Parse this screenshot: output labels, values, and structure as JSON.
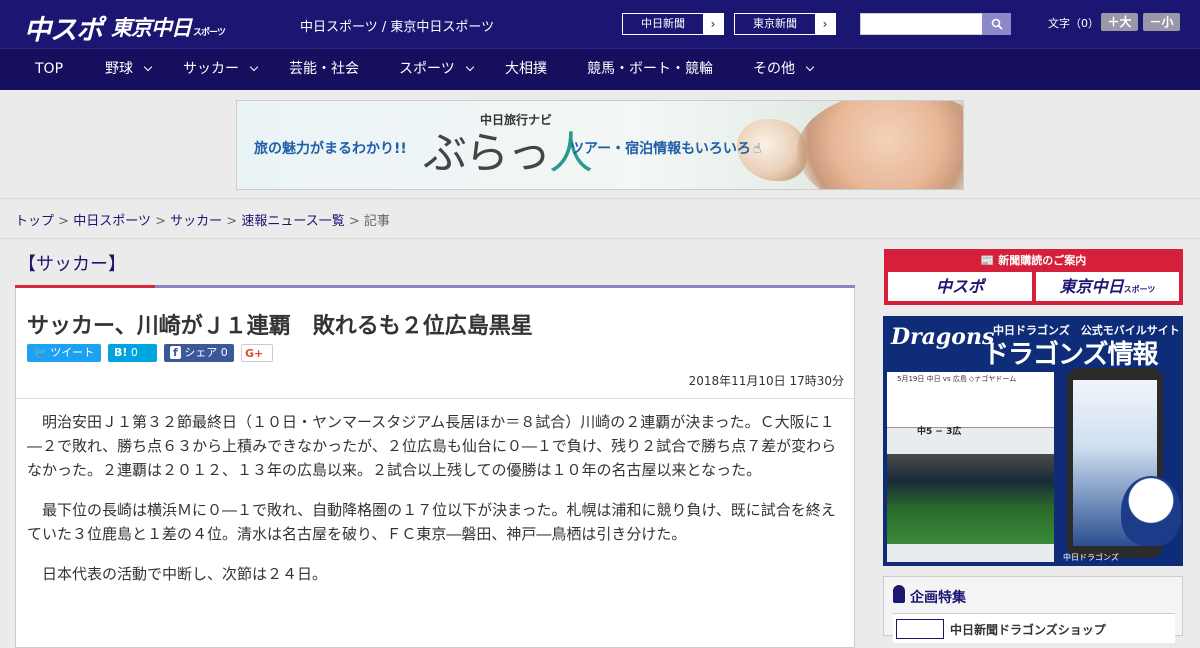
{
  "header": {
    "logo_chuspo": "中スポ",
    "logo_tokyo": "東京中日",
    "logo_tokyo_small": "スポーツ",
    "site_name": "中日スポーツ / 東京中日スポーツ",
    "paper_links": [
      {
        "label": "中日新聞",
        "arrow": "›"
      },
      {
        "label": "東京新聞",
        "arrow": "›"
      }
    ],
    "search_placeholder": "",
    "font_label": "文字（0）",
    "font_larger": "＋大",
    "font_smaller": "－小"
  },
  "nav": {
    "items": [
      {
        "label": "TOP",
        "has_menu": false
      },
      {
        "label": "野球",
        "has_menu": true
      },
      {
        "label": "サッカー",
        "has_menu": true
      },
      {
        "label": "芸能・社会",
        "has_menu": false
      },
      {
        "label": "スポーツ",
        "has_menu": true
      },
      {
        "label": "大相撲",
        "has_menu": false
      },
      {
        "label": "競馬・ボート・競輪",
        "has_menu": false
      },
      {
        "label": "その他",
        "has_menu": true
      }
    ]
  },
  "ad_banner": {
    "left_text": "旅の魅力がまるわかり!!",
    "navi_label": "中日旅行ナビ",
    "title_a": "ぶらっ",
    "title_b": "人",
    "right_text": "ツアー・宿泊情報もいろいろ"
  },
  "breadcrumb": {
    "items": [
      "トップ",
      "中日スポーツ",
      "サッカー",
      "速報ニュース一覧"
    ],
    "current": "記事",
    "separator": ">"
  },
  "article": {
    "category": "【サッカー】",
    "headline": "サッカー、川崎がＪ１連覇　敗れるも２位広島黒星",
    "share": {
      "tweet": "ツイート",
      "hatena_label": "B!",
      "hatena_count": "0",
      "facebook_label": "シェア",
      "facebook_count": "0",
      "gplus": "G+"
    },
    "date": "2018年11月10日 17時30分",
    "paragraphs": [
      "明治安田Ｊ１第３２節最終日（１０日・ヤンマースタジアム長居ほか＝８試合）川崎の２連覇が決まった。Ｃ大阪に１―２で敗れ、勝ち点６３から上積みできなかったが、２位広島も仙台に０―１で負け、残り２試合で勝ち点７差が変わらなかった。２連覇は２０１２、１３年の広島以来。２試合以上残しての優勝は１０年の名古屋以来となった。",
      "最下位の長崎は横浜Ｍに０―１で敗れ、自動降格圏の１７位以下が決まった。札幌は浦和に競り負け、既に試合を終えていた３位鹿島と１差の４位。清水は名古屋を破り、ＦＣ東京―磐田、神戸―鳥栖は引き分けた。",
      "日本代表の活動で中断し、次節は２４日。"
    ]
  },
  "sidebar": {
    "subscribe_title": "新聞購読のご案内",
    "subscribe_chuspo": "中スポ",
    "subscribe_tokyo": "東京中日",
    "subscribe_tokyo_small": "スポーツ",
    "dragons_logo": "Dragons",
    "dragons_sub": "中日ドラゴンズ　公式モバイルサイト",
    "dragons_title": "ドラゴンズ情報",
    "dragons_score_date": "5月19日 中日 vs 広島 ◇ナゴヤドーム",
    "dragons_score": "中5 − 3広",
    "dragons_footer": "中日ドラゴンズ",
    "feature_title": "企画特集",
    "feature_item": "中日新聞ドラゴンズショップ"
  },
  "colors": {
    "header_bg": "#1c1673",
    "nav_bg": "#150f5e",
    "accent_red": "#d82a3a",
    "twitter": "#1da1f2",
    "hatena": "#00a4de",
    "facebook": "#3b5998"
  }
}
